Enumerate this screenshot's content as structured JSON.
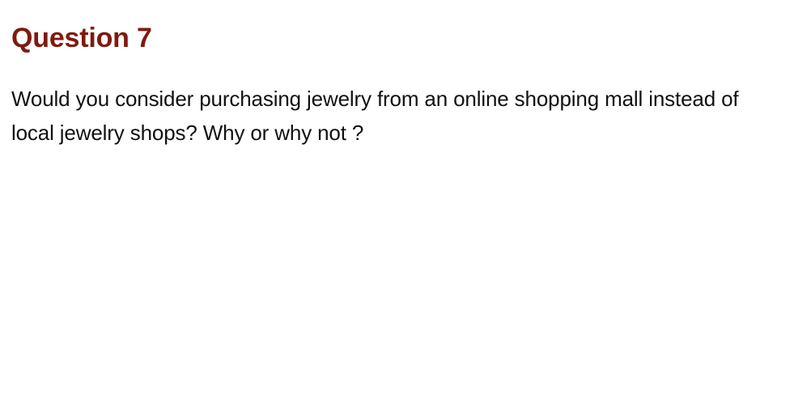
{
  "question": {
    "title": "Question 7",
    "text": "Would you consider purchasing jewelry from an online shopping mall instead of local jewelry shops? Why or why not ?"
  },
  "colors": {
    "title": "#7f1a0f",
    "body_text": "#111111",
    "background": "#ffffff"
  }
}
